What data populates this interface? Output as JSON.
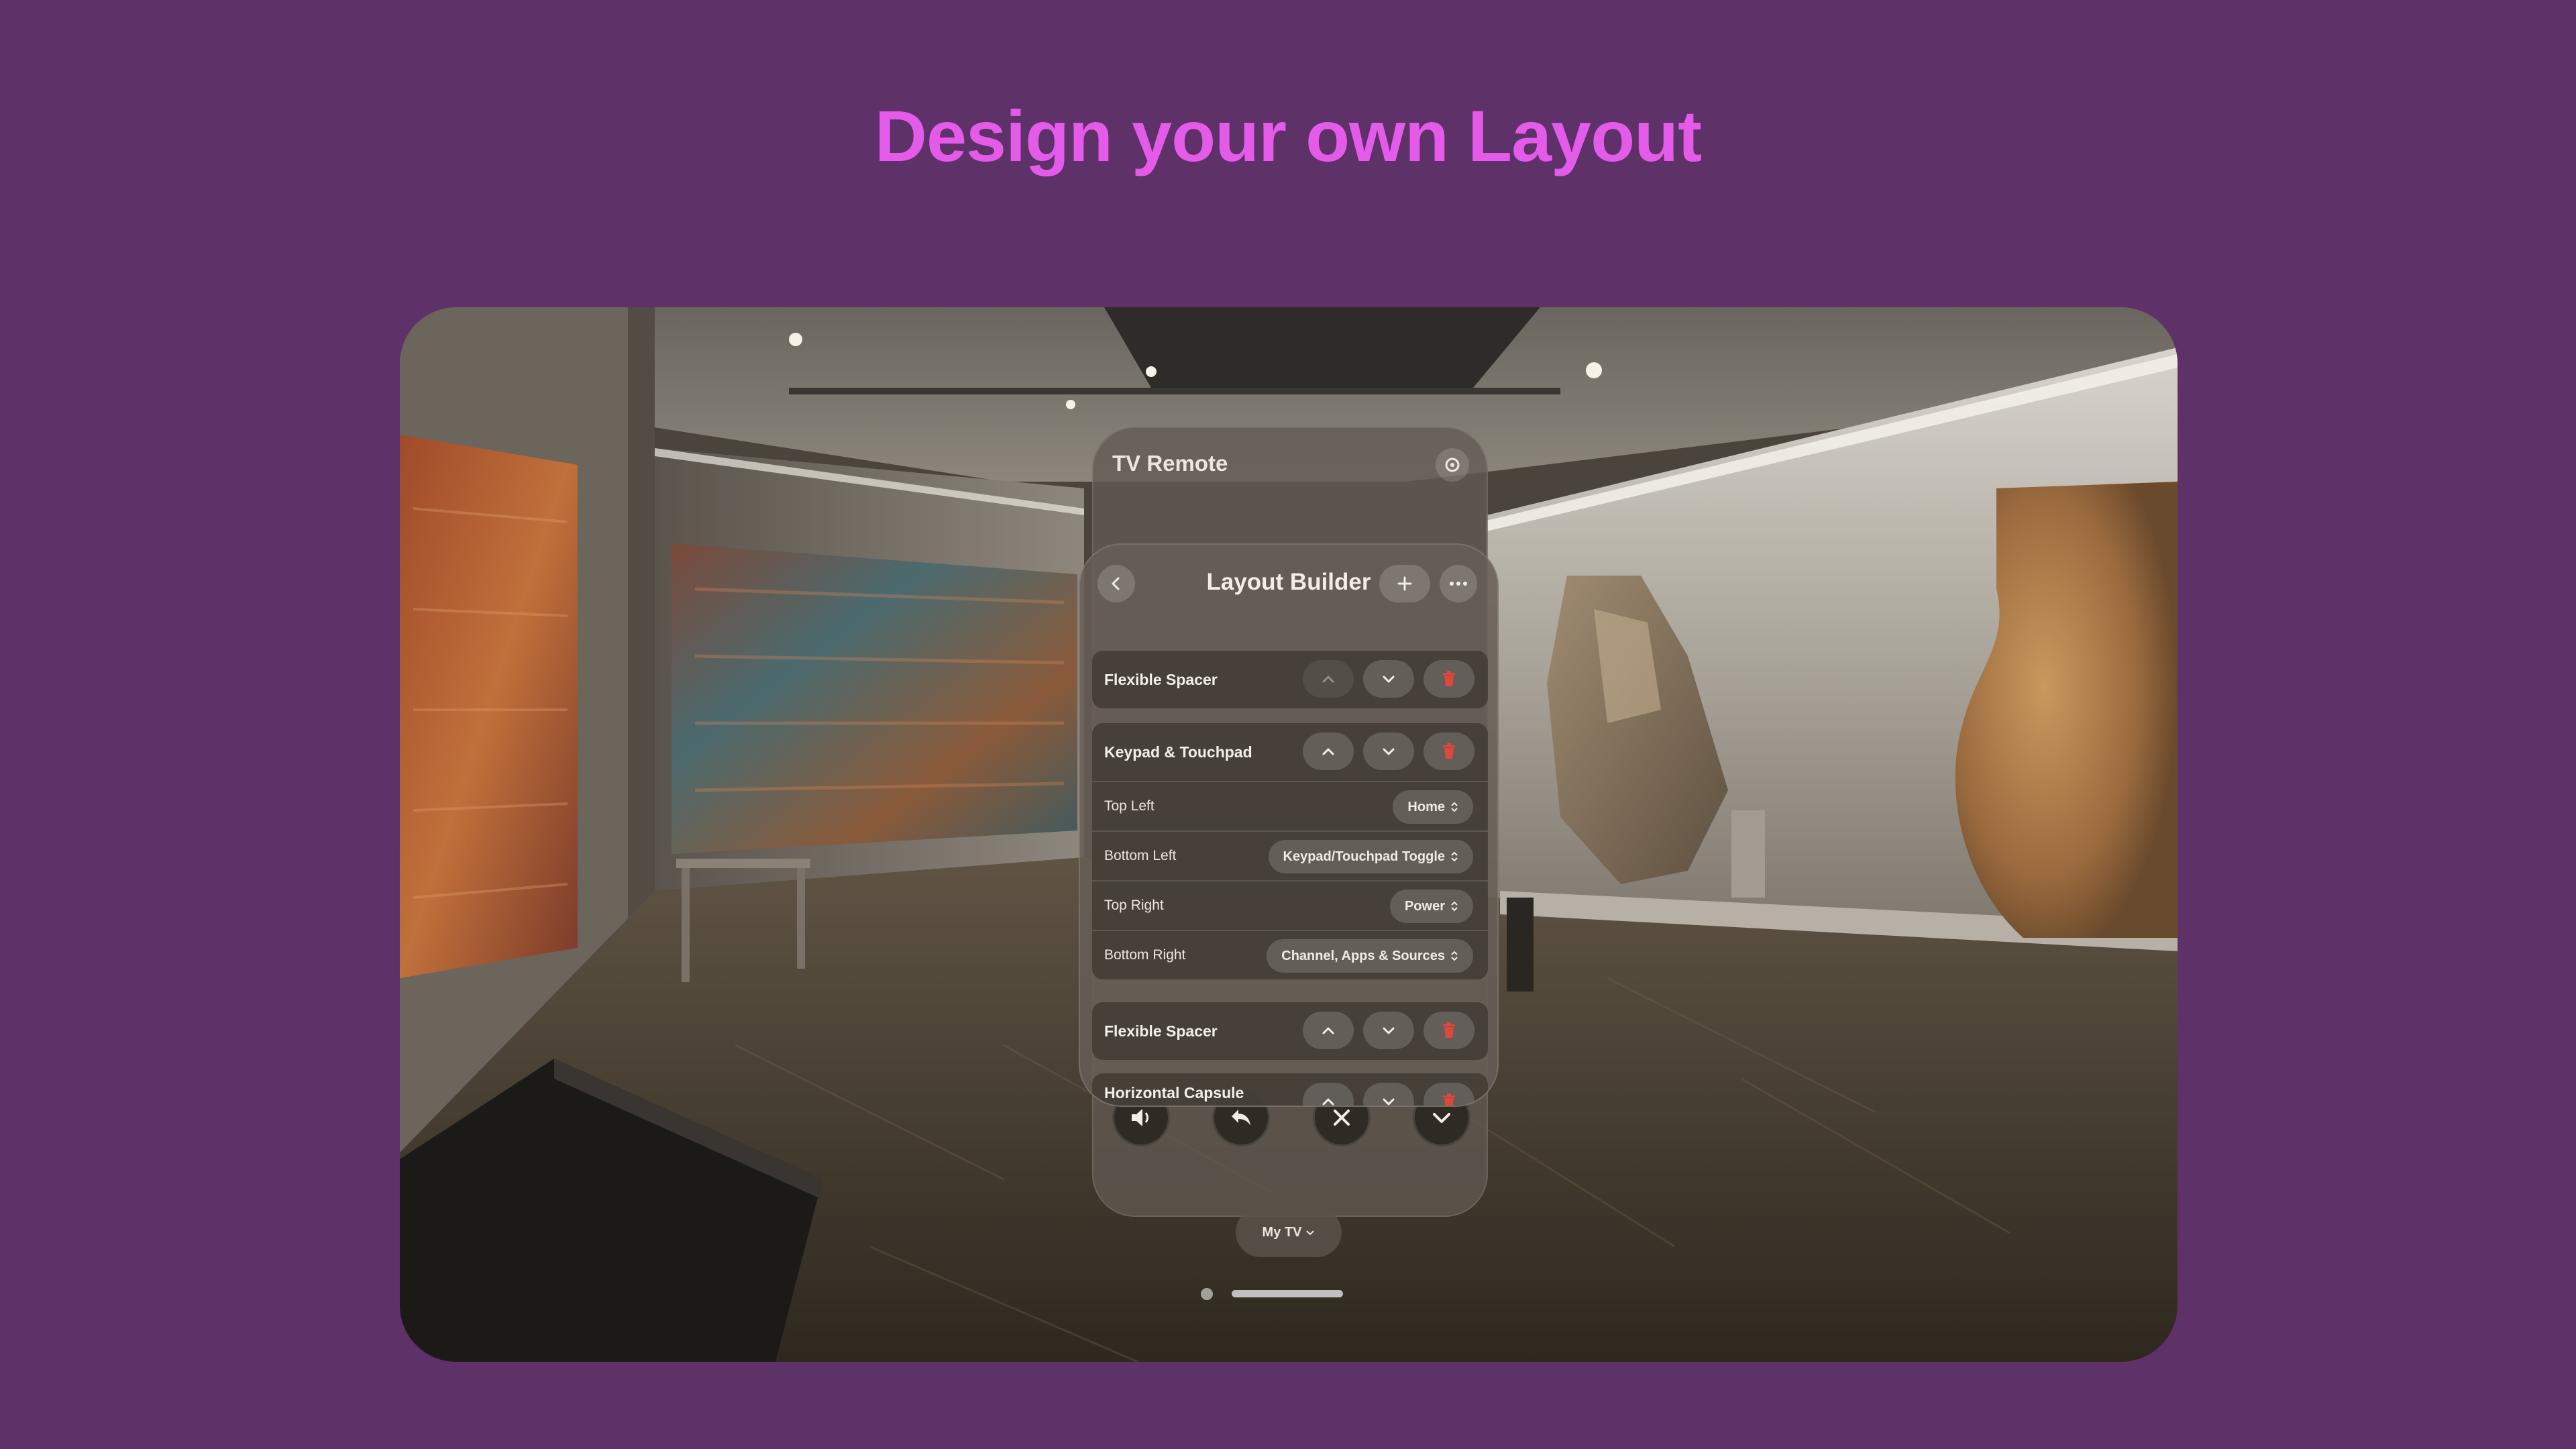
{
  "headline": "Design your own Layout",
  "remote": {
    "title": "TV Remote",
    "device": "My TV",
    "icons": [
      "gear-icon",
      "speaker-icon",
      "undo-icon",
      "close-icon",
      "chevron-down-icon"
    ]
  },
  "builder": {
    "title": "Layout Builder",
    "items": [
      {
        "title": "Flexible Spacer",
        "up_enabled": false
      },
      {
        "title": "Keypad & Touchpad",
        "up_enabled": true,
        "options": [
          {
            "label": "Top Left",
            "value": "Home"
          },
          {
            "label": "Bottom Left",
            "value": "Keypad/Touchpad Toggle"
          },
          {
            "label": "Top Right",
            "value": "Power"
          },
          {
            "label": "Bottom Right",
            "value": "Channel, Apps & Sources"
          }
        ]
      },
      {
        "title": "Flexible Spacer",
        "up_enabled": true
      },
      {
        "title": "Horizontal Capsule",
        "up_enabled": true
      }
    ]
  },
  "colors": {
    "background": "#5e3169",
    "headline": "#e45bea",
    "delete": "#e0463c"
  }
}
